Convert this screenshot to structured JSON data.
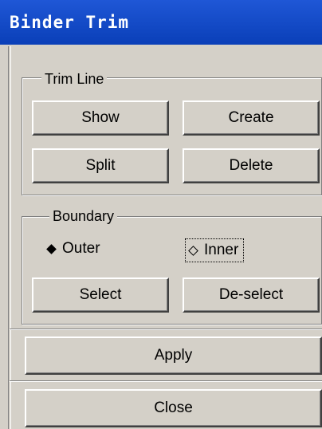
{
  "window": {
    "title": "Binder Trim"
  },
  "trim_line": {
    "legend": "Trim Line",
    "show_label": "Show",
    "create_label": "Create",
    "split_label": "Split",
    "delete_label": "Delete"
  },
  "boundary": {
    "legend": "Boundary",
    "outer_label": "Outer",
    "inner_label": "Inner",
    "selected": "Outer",
    "select_label": "Select",
    "deselect_label": "De-select"
  },
  "actions": {
    "apply_label": "Apply",
    "close_label": "Close"
  }
}
